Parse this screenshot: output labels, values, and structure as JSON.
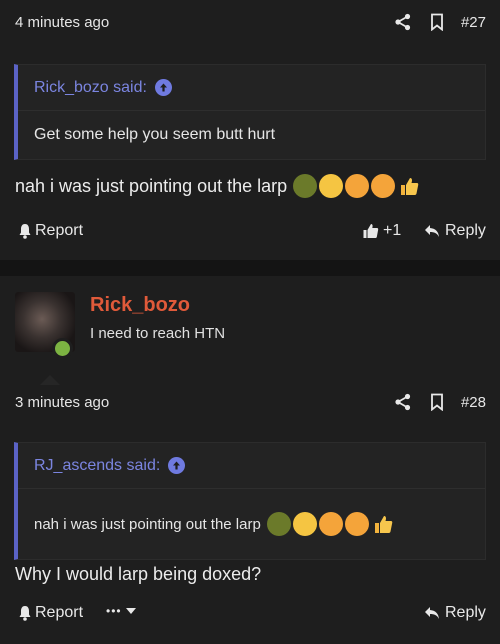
{
  "post27": {
    "time": "4 minutes ago",
    "number": "#27",
    "quote": {
      "author": "Rick_bozo said:",
      "text": "Get some help you seem butt hurt"
    },
    "message": "nah i was just pointing out the larp",
    "reactions_count": "+1",
    "report_label": "Report",
    "reply_label": "Reply"
  },
  "post28": {
    "username": "Rick_bozo",
    "user_title": "I need to reach HTN",
    "time": "3 minutes ago",
    "number": "#28",
    "quote": {
      "author": "RJ_ascends said:",
      "text": "nah i was just pointing out the larp"
    },
    "message": "Why I would larp being doxed?",
    "report_label": "Report",
    "more_label": "•••",
    "reply_label": "Reply"
  },
  "colors": {
    "accent": "#5b63c6",
    "username": "#e05a3a",
    "online": "#7cb342"
  },
  "icons": [
    "share-icon",
    "bookmark-icon",
    "arrow-up-circle-icon",
    "bell-icon",
    "thumbs-up-icon",
    "reply-icon",
    "chevron-down-icon"
  ]
}
